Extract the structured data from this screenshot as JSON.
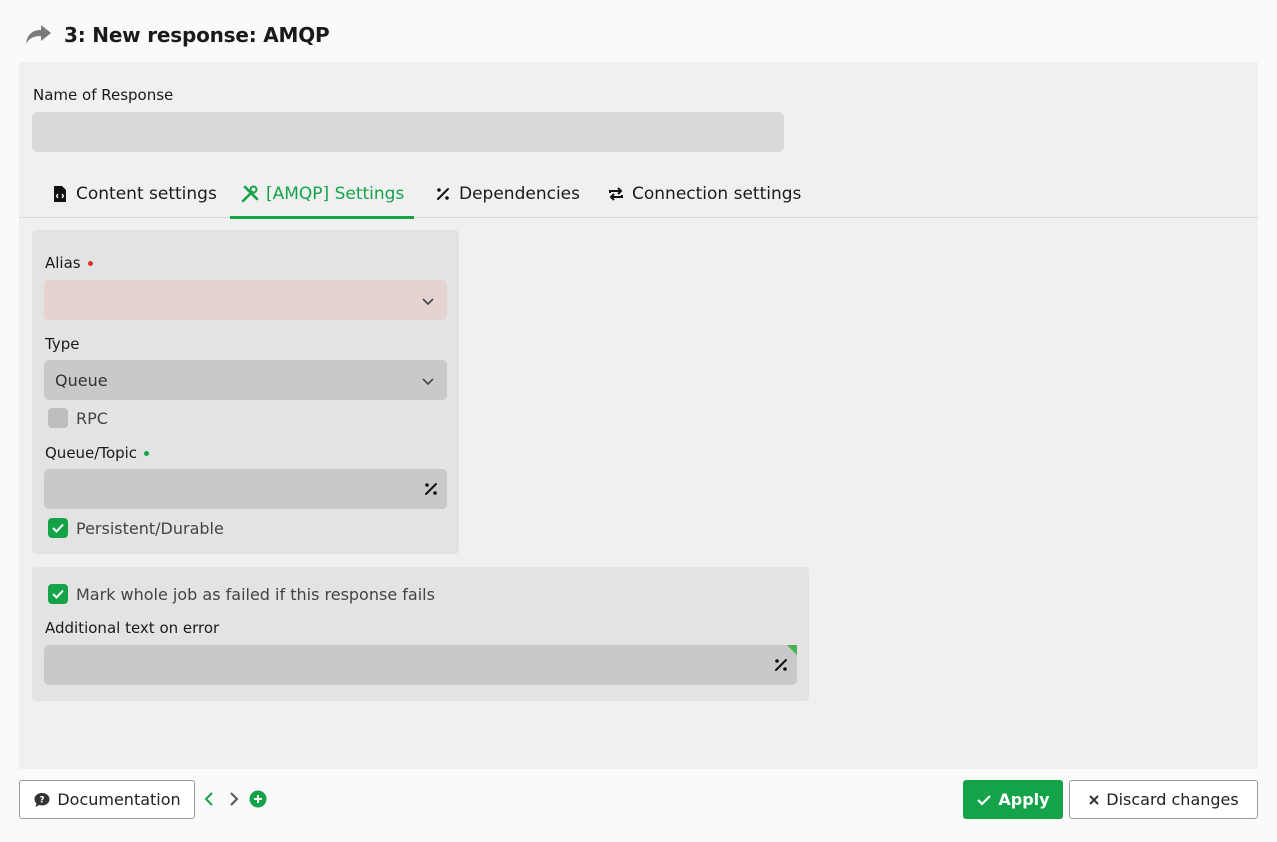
{
  "header": {
    "title": "3: New response: AMQP",
    "icon": "share-arrow-icon"
  },
  "form": {
    "name_label": "Name of Response",
    "name_value": ""
  },
  "tabs": [
    {
      "label": "Content settings",
      "icon": "file-code-icon",
      "active": false
    },
    {
      "label": "[AMQP] Settings",
      "icon": "tools-icon",
      "active": true
    },
    {
      "label": "Dependencies",
      "icon": "percent-icon",
      "active": false
    },
    {
      "label": "Connection settings",
      "icon": "sync-icon",
      "active": false
    }
  ],
  "amqp": {
    "alias_label": "Alias",
    "alias_value": "",
    "type_label": "Type",
    "type_value": "Queue",
    "rpc_label": "RPC",
    "rpc_checked": false,
    "queue_label": "Queue/Topic",
    "queue_value": "",
    "persistent_label": "Persistent/Durable",
    "persistent_checked": true
  },
  "error": {
    "fail_label": "Mark whole job as failed if this response fails",
    "fail_checked": true,
    "text_label": "Additional text on error",
    "text_value": ""
  },
  "footer": {
    "documentation": "Documentation",
    "apply": "Apply",
    "discard": "Discard changes"
  },
  "colors": {
    "accent": "#15a34a",
    "required_dot": "#e03131",
    "invalid_bg": "#e5d3d2"
  }
}
